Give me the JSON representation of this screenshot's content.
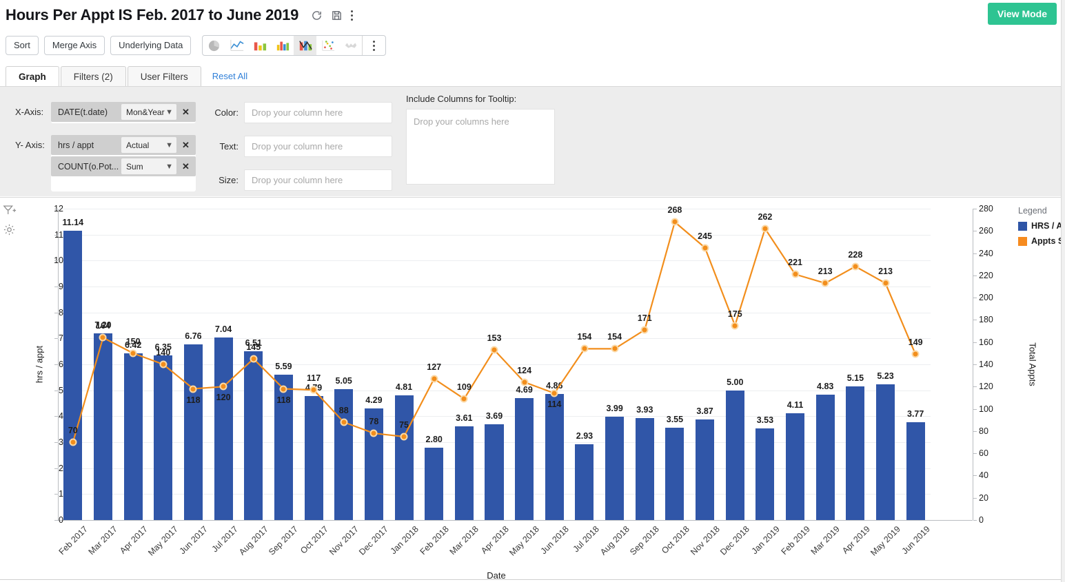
{
  "header": {
    "title": "Hours Per Appt IS Feb. 2017 to June 2019",
    "icons": [
      "refresh-icon",
      "save-icon",
      "more-vertical-icon"
    ],
    "view_mode_label": "View Mode"
  },
  "toolbar": {
    "buttons": [
      "Sort",
      "Merge Axis",
      "Underlying Data"
    ],
    "chart_types": [
      {
        "name": "pie-chart-icon",
        "selected": false
      },
      {
        "name": "line-chart-icon",
        "selected": false
      },
      {
        "name": "bar-chart-icon",
        "selected": false
      },
      {
        "name": "grouped-bar-chart-icon",
        "selected": false
      },
      {
        "name": "combo-chart-icon",
        "selected": true
      },
      {
        "name": "scatter-plot-icon",
        "selected": false
      },
      {
        "name": "map-chart-icon",
        "selected": false
      }
    ],
    "overflow": "more-vertical-icon"
  },
  "tabs": {
    "items": [
      {
        "label": "Graph",
        "active": true
      },
      {
        "label": "Filters  (2)",
        "active": false
      },
      {
        "label": "User Filters",
        "active": false
      }
    ],
    "reset_all": "Reset All"
  },
  "shelf": {
    "x_axis_label": "X-Axis:",
    "y_axis_label": "Y- Axis:",
    "x_pills": [
      {
        "field": "DATE(t.date)",
        "agg": "Mon&Year"
      }
    ],
    "y_pills": [
      {
        "field": "hrs / appt",
        "agg": "Actual"
      },
      {
        "field": "COUNT(o.Pot...",
        "agg": "Sum"
      }
    ],
    "drops": [
      {
        "label": "Color:",
        "placeholder": "Drop your column here"
      },
      {
        "label": "Text:",
        "placeholder": "Drop your column here"
      },
      {
        "label": "Size:",
        "placeholder": "Drop your column here"
      }
    ],
    "tooltip_title": "Include Columns for Tooltip:",
    "tooltip_placeholder": "Drop your columns here"
  },
  "side_tools": [
    "add-filter-icon",
    "settings-gear-icon"
  ],
  "legend": {
    "title": "Legend",
    "items": [
      {
        "label": "HRS / A",
        "color": "#2e55a6"
      },
      {
        "label": "Appts S",
        "color": "#f68b1f"
      }
    ]
  },
  "chart_data": {
    "type": "bar",
    "title": "Hours Per Appt IS Feb. 2017 to June 2019",
    "xlabel": "Date",
    "ylabel": "hrs / appt",
    "y2label": "Total Appts",
    "ylim": [
      0,
      12
    ],
    "y2lim": [
      0,
      280
    ],
    "yticks": [
      0,
      1,
      2,
      3,
      4,
      5,
      6,
      7,
      8,
      9,
      10,
      11,
      12
    ],
    "y2ticks": [
      0,
      20,
      40,
      60,
      80,
      100,
      120,
      140,
      160,
      180,
      200,
      220,
      240,
      260,
      280
    ],
    "grid": true,
    "legend_position": "right",
    "categories": [
      "Feb 2017",
      "Mar 2017",
      "Apr 2017",
      "May 2017",
      "Jun 2017",
      "Jul 2017",
      "Aug 2017",
      "Sep 2017",
      "Oct 2017",
      "Nov 2017",
      "Dec 2017",
      "Jan 2018",
      "Feb 2018",
      "Mar 2018",
      "Apr 2018",
      "May 2018",
      "Jun 2018",
      "Jul 2018",
      "Aug 2018",
      "Sep 2018",
      "Oct 2018",
      "Nov 2018",
      "Dec 2018",
      "Jan 2019",
      "Feb 2019",
      "Mar 2019",
      "Apr 2019",
      "May 2019",
      "Jun 2019"
    ],
    "series": [
      {
        "name": "HRS / APPT",
        "type": "bar",
        "axis": "left",
        "color": "#3056a8",
        "values": [
          11.14,
          7.2,
          6.42,
          6.35,
          6.76,
          7.04,
          6.51,
          5.59,
          4.79,
          5.05,
          4.29,
          4.81,
          2.8,
          3.61,
          3.69,
          4.69,
          4.86,
          2.93,
          3.99,
          3.93,
          3.55,
          3.87,
          5.0,
          3.53,
          4.11,
          4.83,
          5.15,
          5.23,
          3.77
        ]
      },
      {
        "name": "Appts Scheduled",
        "type": "line",
        "axis": "right",
        "color": "#f28e1c",
        "values": [
          70,
          164,
          150,
          140,
          118,
          120,
          145,
          118,
          117,
          88,
          78,
          75,
          127,
          109,
          153,
          124,
          114,
          154,
          154,
          171,
          268,
          245,
          175,
          262,
          221,
          213,
          228,
          213,
          149
        ]
      }
    ]
  }
}
